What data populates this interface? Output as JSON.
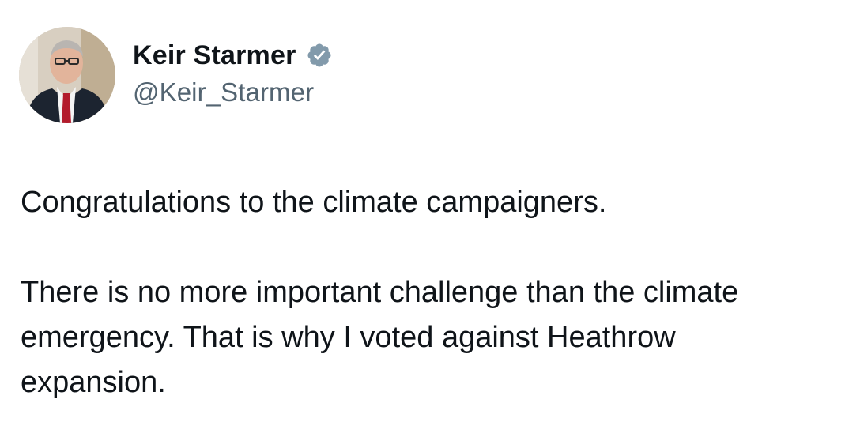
{
  "author": {
    "name": "Keir Starmer",
    "handle": "@Keir_Starmer",
    "verified": true,
    "avatar_icon": "profile-photo-icon",
    "verified_icon": "verified-badge-icon"
  },
  "tweet": {
    "paragraphs": [
      "Congratulations to the climate campaigners.",
      "There is no more important challenge than the climate emergency. That is why I voted against Heathrow expansion."
    ]
  },
  "colors": {
    "text": "#0f1419",
    "secondary_text": "#536471",
    "verified_badge": "#829aab",
    "background": "#ffffff"
  }
}
